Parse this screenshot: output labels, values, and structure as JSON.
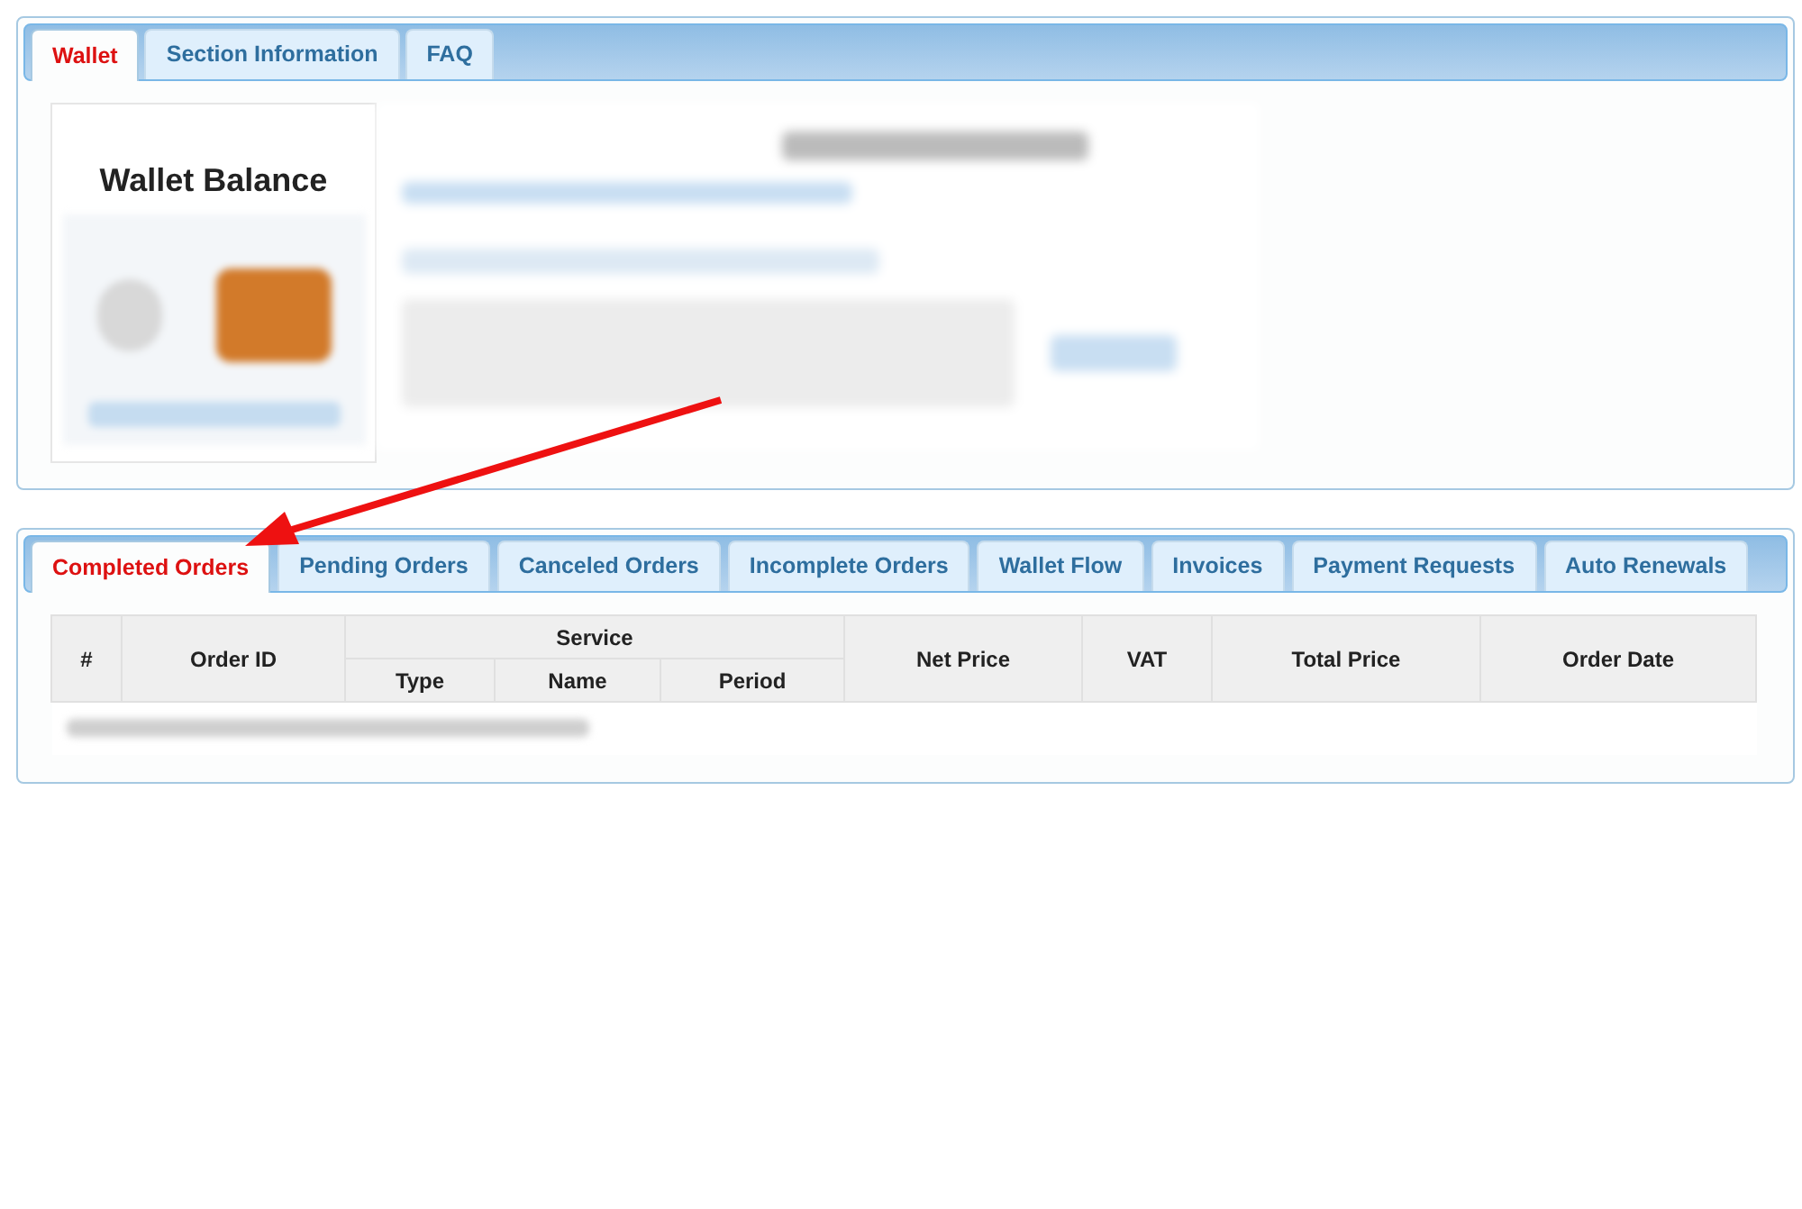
{
  "wallet_panel": {
    "tabs": [
      {
        "label": "Wallet",
        "selected": true
      },
      {
        "label": "Section Information",
        "selected": false
      },
      {
        "label": "FAQ",
        "selected": false
      }
    ],
    "balance_card": {
      "title": "Wallet Balance"
    }
  },
  "orders_panel": {
    "tabs": [
      {
        "label": "Completed Orders",
        "selected": true
      },
      {
        "label": "Pending Orders",
        "selected": false
      },
      {
        "label": "Canceled Orders",
        "selected": false
      },
      {
        "label": "Incomplete Orders",
        "selected": false
      },
      {
        "label": "Wallet Flow",
        "selected": false
      },
      {
        "label": "Invoices",
        "selected": false
      },
      {
        "label": "Payment Requests",
        "selected": false
      },
      {
        "label": "Auto Renewals",
        "selected": false
      }
    ],
    "table": {
      "columns": [
        "#",
        "Order ID",
        "Service",
        "Net Price",
        "VAT",
        "Total Price",
        "Order Date"
      ],
      "service_subcolumns": [
        "Type",
        "Name",
        "Period"
      ]
    }
  }
}
